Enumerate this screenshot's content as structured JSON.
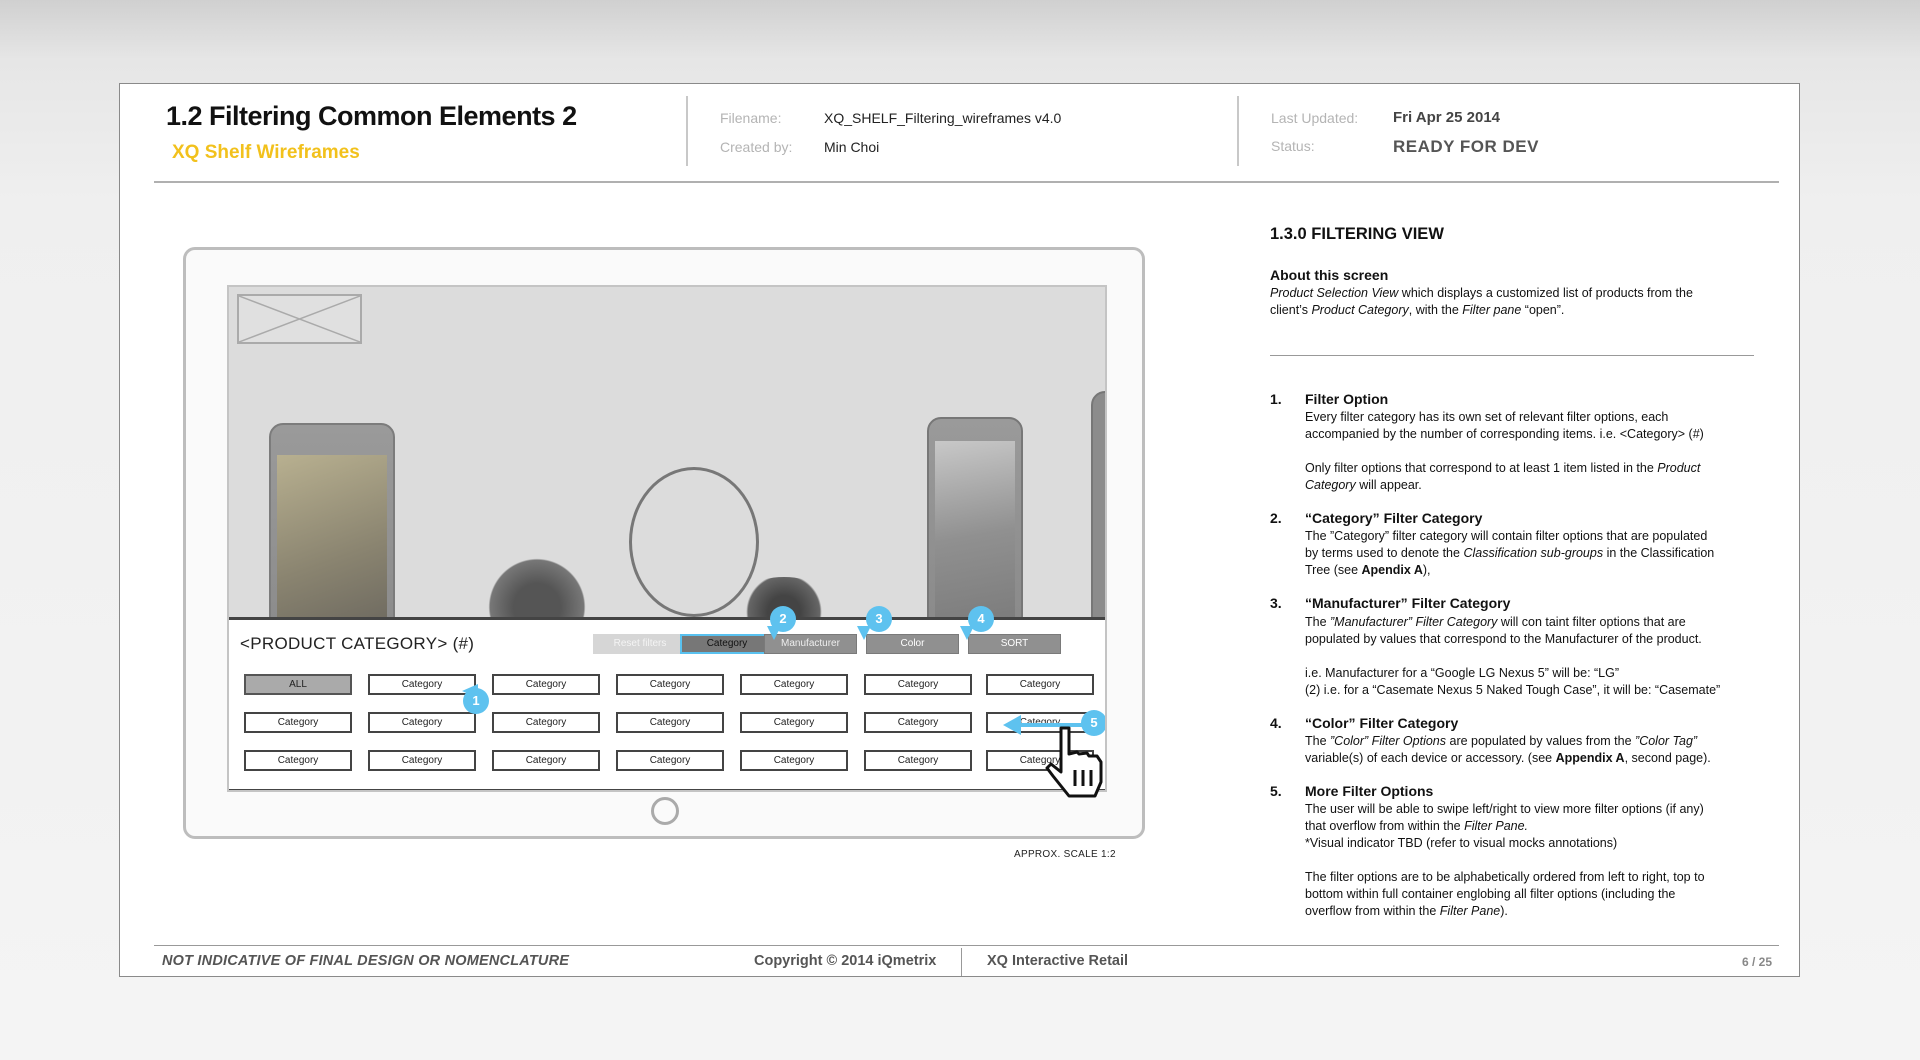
{
  "header": {
    "title": "1.2 Filtering Common Elements 2",
    "subtitle": "XQ Shelf Wireframes",
    "filename_label": "Filename:",
    "filename_value": "XQ_SHELF_Filtering_wireframes v4.0",
    "created_label": "Created by:",
    "created_value": "Min Choi",
    "updated_label": "Last Updated:",
    "updated_value": "Fri Apr 25 2014",
    "status_label": "Status:",
    "status_value": "READY FOR DEV"
  },
  "wireframe": {
    "pane_title": "<PRODUCT CATEGORY> (#)",
    "tabs": [
      "Reset filters",
      "Category",
      "Manufacturer",
      "Color",
      "SORT"
    ],
    "options": [
      [
        "ALL",
        "Category",
        "Category",
        "Category",
        "Category",
        "Category",
        "Category"
      ],
      [
        "Category",
        "Category",
        "Category",
        "Category",
        "Category",
        "Category",
        "Category"
      ],
      [
        "Category",
        "Category",
        "Category",
        "Category",
        "Category",
        "Category",
        "Category"
      ]
    ],
    "badges": [
      "1",
      "2",
      "3",
      "4",
      "5"
    ],
    "scale": "APPROX. SCALE 1:2"
  },
  "notes": {
    "section_title": "1.3.0 FILTERING VIEW",
    "about_title": "About this screen",
    "about_line1_em": "Product Selection View",
    "about_line1_rest": " which displays a customized list of products from the",
    "about_line2_pre": "client’s ",
    "about_line2_em1": "Product Category",
    "about_line2_mid": ", with the ",
    "about_line2_em2": "Filter pane",
    "about_line2_post": " “open”.",
    "items": [
      {
        "num": "1.",
        "title": "Filter Option",
        "p1a": "Every filter category has its own set of relevant filter options, each",
        "p1b": "accompanied by the number of corresponding items.      i.e. <Category> (#)",
        "p2a_pre": "Only filter options that correspond to at least 1 item listed in the ",
        "p2a_em": "Product",
        "p2b_em": "Category",
        "p2b_post": " will appear."
      },
      {
        "num": "2.",
        "title": "“Category” Filter Category",
        "pa": "The ”Category” filter category will contain filter options that are populated",
        "pb_pre": "by terms used to denote the ",
        "pb_em": "Classification sub-groups",
        "pb_post": " in the Classification",
        "pc_pre": "Tree (see ",
        "pc_b": "Apendix A",
        "pc_post": "),"
      },
      {
        "num": "3.",
        "title": "“Manufacturer” Filter Category",
        "pa_pre": "The ",
        "pa_em": "”Manufacturer” Filter Category",
        "pa_post": " will con taint filter options that are",
        "pb": "populated by values that correspond to the Manufacturer of the product.",
        "pc": "i.e. Manufacturer for a “Google LG Nexus 5” will be: “LG”",
        "pd": "(2) i.e. for a “Casemate Nexus 5 Naked Tough Case”, it will be: “Casemate”"
      },
      {
        "num": "4.",
        "title": "“Color” Filter Category",
        "pa_pre": "The ",
        "pa_em": "”Color” Filter Options",
        "pa_mid": " are populated by values from the ",
        "pa_em2": "”Color Tag”",
        "pb_pre": "variable(s) of each device or accessory. (see ",
        "pb_b": "Appendix A",
        "pb_post": ", second page)."
      },
      {
        "num": "5.",
        "title": "More Filter Options",
        "pa": "The user will be able to swipe left/right to view more filter options (if any)",
        "pb_pre": "that overflow from within the ",
        "pb_em": "Filter Pane.",
        "pc": "*Visual indicator TBD (refer to visual mocks annotations)",
        "pd": "The filter options are to be alphabetically ordered from left to right, top to",
        "pe": "bottom within full container englobing all filter options (including the",
        "pf_pre": "overflow from within the ",
        "pf_em": "Filter Pane",
        "pf_post": ")."
      }
    ]
  },
  "footer": {
    "disclaimer": "NOT INDICATIVE OF FINAL DESIGN OR NOMENCLATURE",
    "copyright": "Copyright © 2014 iQmetrix",
    "company": "XQ Interactive Retail",
    "page": "6 / 25"
  },
  "colors": {
    "accent_yellow": "#f2c11c",
    "badge_blue": "#5ec2ef"
  }
}
